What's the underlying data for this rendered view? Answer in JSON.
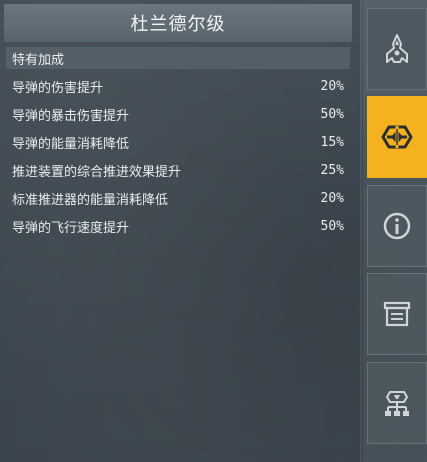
{
  "panel": {
    "title": "杜兰德尔级",
    "section_title": "特有加成",
    "bonuses": [
      {
        "label": "导弹的伤害提升",
        "value": "20%"
      },
      {
        "label": "导弹的暴击伤害提升",
        "value": "50%"
      },
      {
        "label": "导弹的能量消耗降低",
        "value": "15%"
      },
      {
        "label": "推进装置的综合推进效果提升",
        "value": "25%"
      },
      {
        "label": "标准推进器的能量消耗降低",
        "value": "20%"
      },
      {
        "label": "导弹的飞行速度提升",
        "value": "50%"
      }
    ]
  },
  "side_tabs": [
    {
      "icon": "ship-icon",
      "active": false
    },
    {
      "icon": "faction-emblem-icon",
      "active": true
    },
    {
      "icon": "info-icon",
      "active": false
    },
    {
      "icon": "archive-box-icon",
      "active": false
    },
    {
      "icon": "tech-tree-icon",
      "active": false
    }
  ],
  "colors": {
    "accent": "#f3b21e"
  }
}
